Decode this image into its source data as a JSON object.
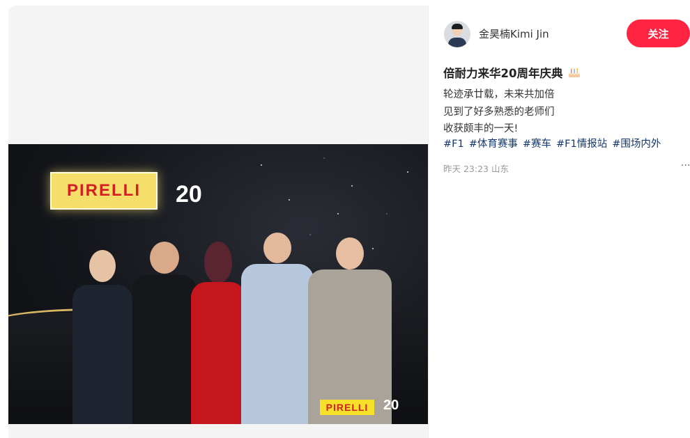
{
  "author": {
    "name": "金昊楠Kimi Jin",
    "follow_label": "关注"
  },
  "note": {
    "title": "倍耐力来华20周年庆典",
    "title_emoji": "birthday-cake-icon",
    "desc_lines": [
      "轮迹承廿载，未来共加倍",
      "见到了好多熟悉的老师们",
      "收获颇丰的一天!"
    ],
    "tags": [
      "#F1",
      "#体育赛事",
      "#赛车",
      "#F1情报站",
      "#围场内外"
    ],
    "time": "昨天 23:23",
    "location": "山东",
    "more_label": "···"
  },
  "photo": {
    "sign_text": "PIRELLI",
    "anniv_text": "20",
    "bottom_sign_text": "PIRELLI",
    "bottom_anniv_text": "20"
  },
  "colors": {
    "accent": "#ff2442",
    "tag": "#13386c",
    "meta": "#999999"
  }
}
